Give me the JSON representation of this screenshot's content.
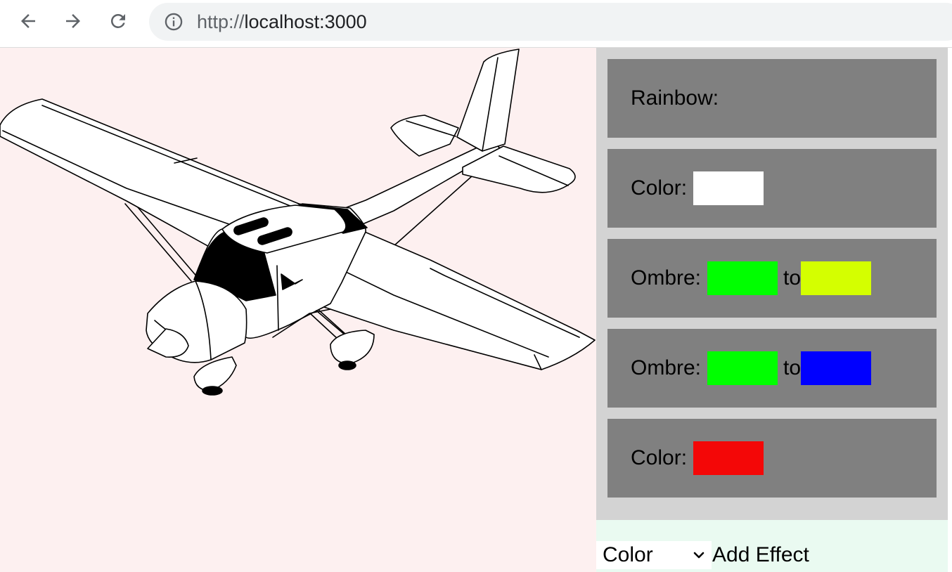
{
  "browser": {
    "url_scheme": "http://",
    "url_host": "localhost:3000",
    "icons": [
      "back-arrow-icon",
      "forward-arrow-icon",
      "reload-icon",
      "info-icon"
    ]
  },
  "effects": [
    {
      "label": "Rainbow:",
      "type": "rainbow",
      "colors": []
    },
    {
      "label": "Color:",
      "type": "color",
      "colors": [
        "#ffffff"
      ]
    },
    {
      "label": "Ombre:",
      "type": "ombre",
      "to_label": "to",
      "colors": [
        "#00ff00",
        "#d4ff00"
      ]
    },
    {
      "label": "Ombre:",
      "type": "ombre",
      "to_label": "to",
      "colors": [
        "#00ff00",
        "#0000ff"
      ]
    },
    {
      "label": "Color:",
      "type": "color",
      "colors": [
        "#f40707"
      ]
    }
  ],
  "controls": {
    "select_value": "Color",
    "add_button_label": "Add Effect"
  },
  "theme": {
    "canvas_bg": "#fdf0f0",
    "panel_bg": "#d3d3d3",
    "card_bg": "#808080",
    "controls_bg": "#eafaf1"
  }
}
